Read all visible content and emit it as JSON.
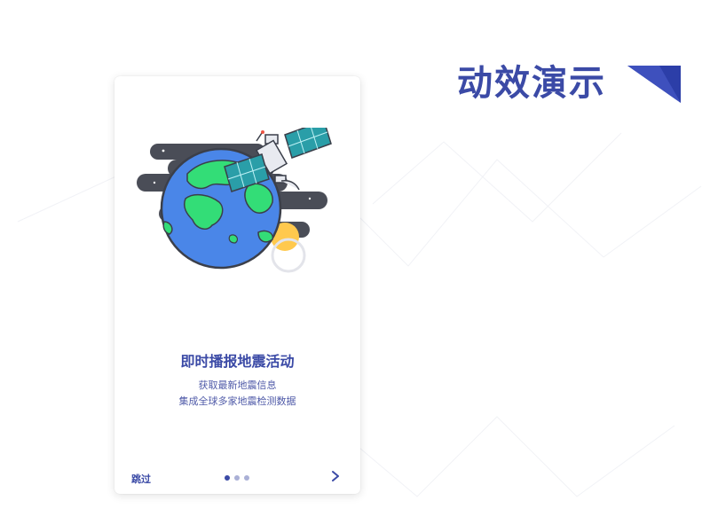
{
  "demo_title": "动效演示",
  "colors": {
    "accent": "#3b4aa6",
    "ocean": "#4a86e8",
    "land": "#33dd77",
    "cloud": "#4a4d57",
    "sun": "#ffc94d"
  },
  "onboarding": {
    "headline": "即时播报地震活动",
    "subtitle_lines": [
      "获取最新地震信息",
      "集成全球多家地震检测数据"
    ],
    "skip_label": "跳过",
    "page_count": 3,
    "active_page": 1,
    "next_icon": "chevron-right-icon",
    "illustration": "earth-satellite-illustration"
  }
}
